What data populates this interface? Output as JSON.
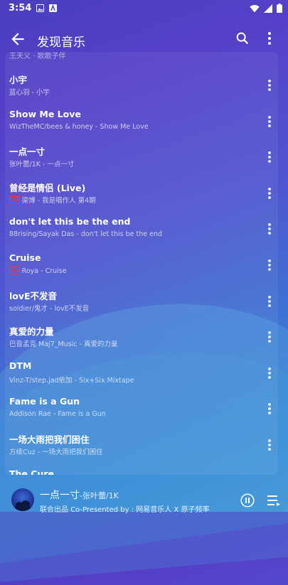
{
  "status_bar": {
    "time": "3:54"
  },
  "app_bar": {
    "title": "发现音乐"
  },
  "list": {
    "partial_top_subtitle": "王天义 · 歌歌子伴",
    "items": [
      {
        "title": "小宇",
        "subtitle": "蓝心羽 - 小宇",
        "badge": ""
      },
      {
        "title": "Show Me Love",
        "subtitle": "WizTheMC/bees & honey - Show Me Love",
        "badge": ""
      },
      {
        "title": "一点一寸",
        "subtitle": "张叶蕾/1K - 一点一寸",
        "badge": ""
      },
      {
        "title": "曾经是情侣 (Live)",
        "subtitle": "梁博 - 我是唱作人 第4期",
        "badge": "SQ"
      },
      {
        "title": "don't let this be the end",
        "subtitle": "88rising/Sayak Das - don't let this be the end",
        "badge": ""
      },
      {
        "title": "Cruise",
        "subtitle": "Roya - Cruise",
        "badge": "SQ"
      },
      {
        "title": "lovE不发音",
        "subtitle": "soldier/鬼才 - lovE不发音",
        "badge": ""
      },
      {
        "title": "真爱的力量",
        "subtitle": "巴音孟克 Maj7_Music - 真爱的力量",
        "badge": ""
      },
      {
        "title": "DTM",
        "subtitle": "Vinz-T/step.jad依加 - Six+Six Mixtape",
        "badge": ""
      },
      {
        "title": "Fame is a Gun",
        "subtitle": "Addison Rae - Fame is a Gun",
        "badge": ""
      },
      {
        "title": "一场大雨把我们困住",
        "subtitle": "方续Cuz - 一场大雨把我们困住",
        "badge": ""
      },
      {
        "title": "The Cure",
        "subtitle": "",
        "badge": ""
      }
    ]
  },
  "player": {
    "title": "一点一寸",
    "artist": "-张叶蕾/1K",
    "subtitle": "联合出品 Co-Presented by : 网易音乐人 X 原子频率"
  }
}
